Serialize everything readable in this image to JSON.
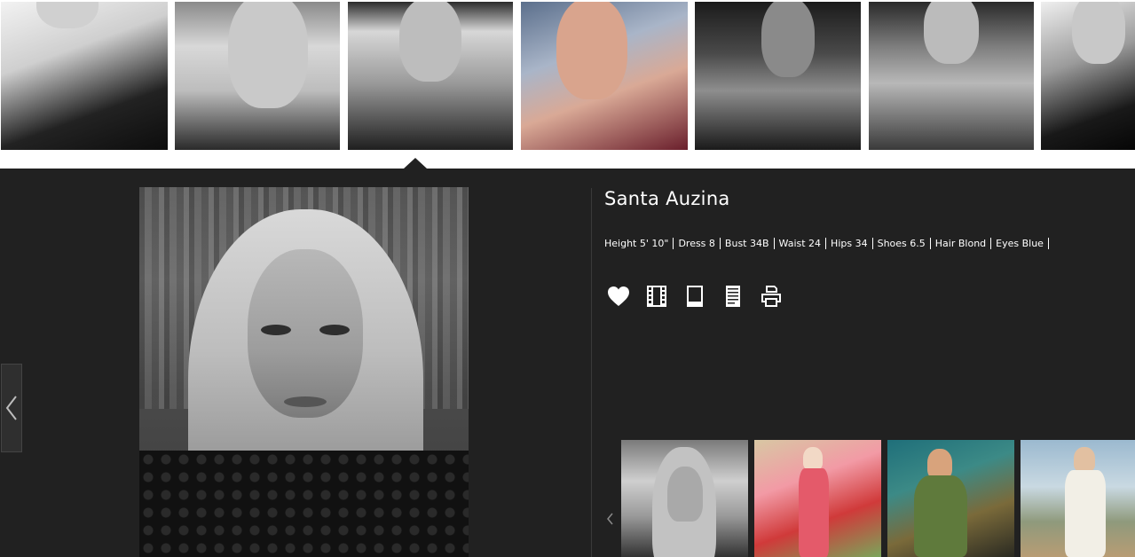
{
  "strip": {
    "items": [
      {
        "alt": "model photo 1"
      },
      {
        "alt": "model photo 2"
      },
      {
        "alt": "model photo 3"
      },
      {
        "alt": "model photo 4"
      },
      {
        "alt": "model photo 5"
      },
      {
        "alt": "model photo 6"
      },
      {
        "alt": "model photo 7"
      }
    ]
  },
  "model": {
    "name": "Santa Auzina",
    "stats": [
      "Height 5' 10\"",
      "Dress 8",
      "Bust 34B",
      "Waist 24",
      "Hips 34",
      "Shoes 6.5",
      "Hair Blond",
      "Eyes Blue"
    ]
  },
  "actions": {
    "icons": [
      "heart-icon",
      "film-icon",
      "tablet-icon",
      "document-icon",
      "print-icon"
    ]
  },
  "colors": {
    "panel_bg": "#212121",
    "text": "#ffffff",
    "page_bg": "#ffffff"
  }
}
